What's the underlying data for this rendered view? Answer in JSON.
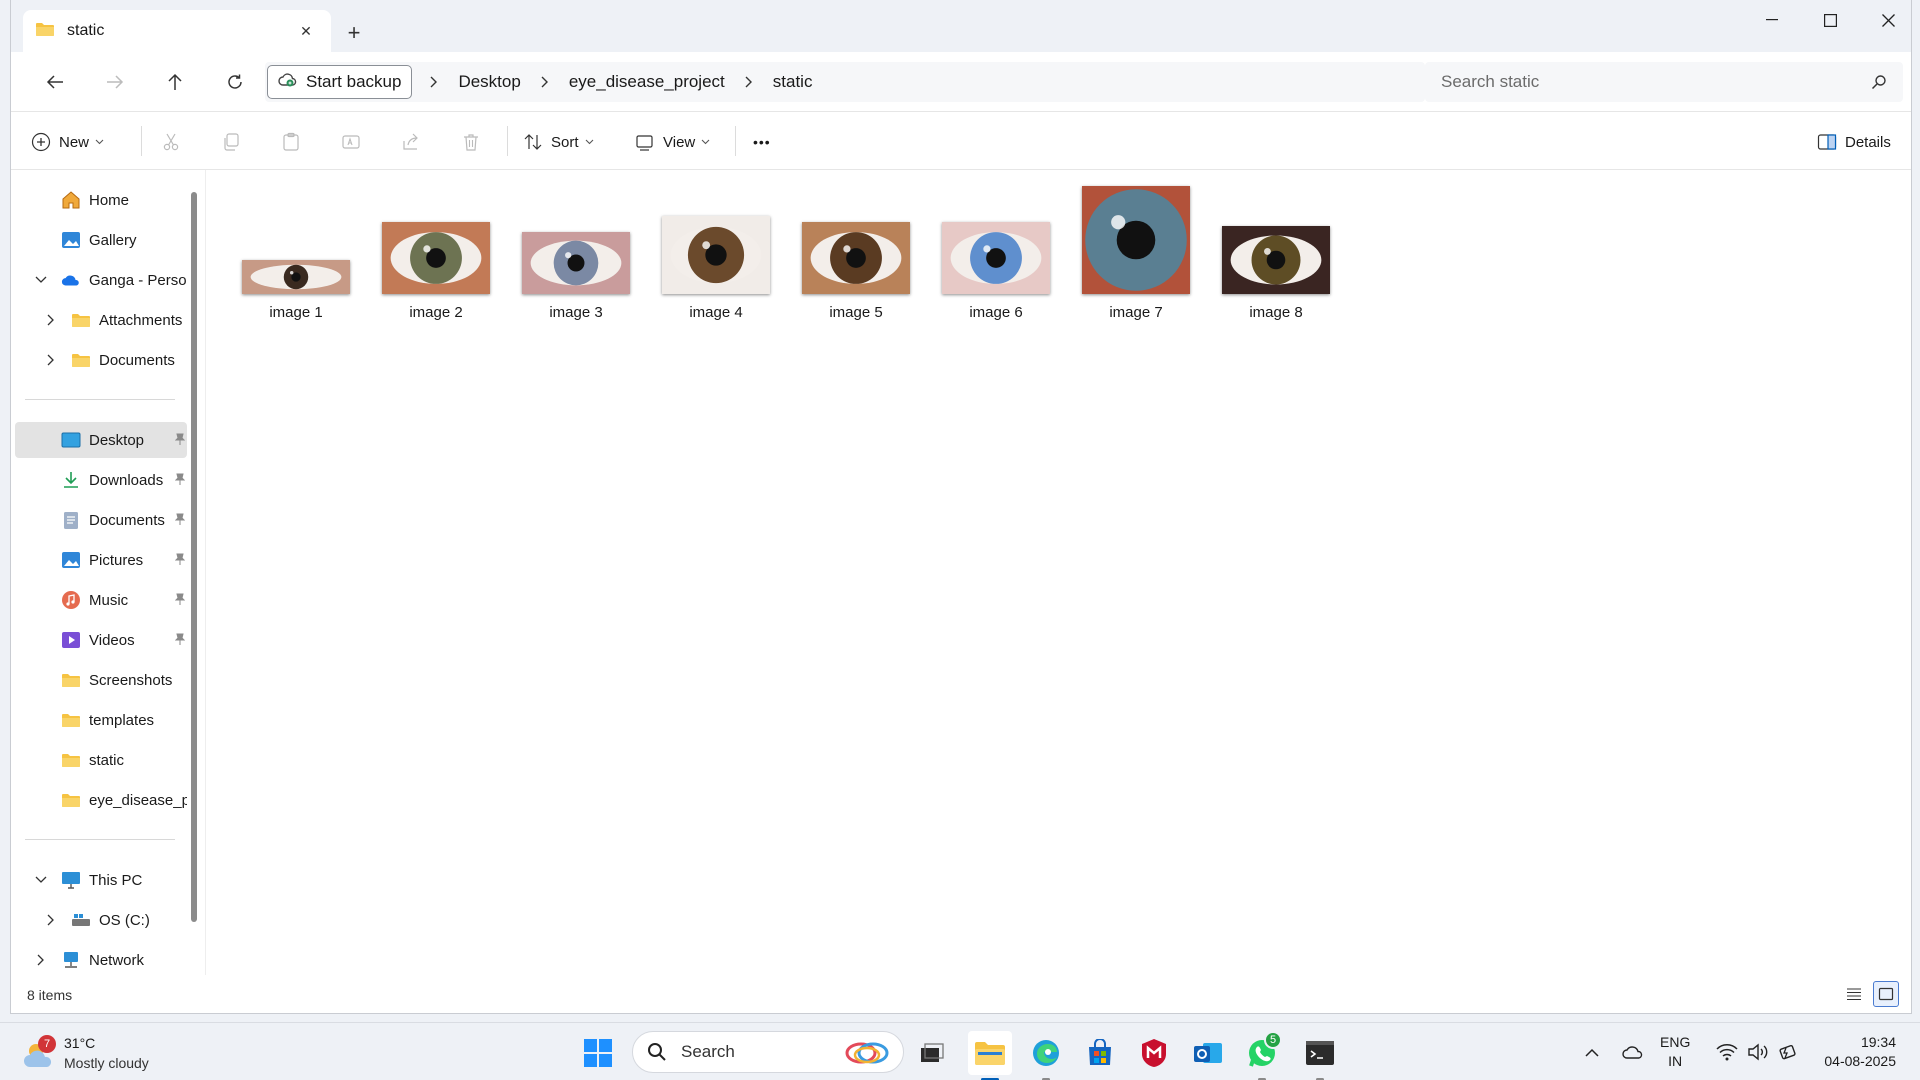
{
  "tab": {
    "title": "static",
    "close_glyph": "✕",
    "new_glyph": "+"
  },
  "window_controls": {
    "minimize": "—",
    "maximize": "☐",
    "close": "✕"
  },
  "address": {
    "backup_label": "Start backup",
    "crumbs": [
      "Desktop",
      "eye_disease_project",
      "static"
    ],
    "search_placeholder": "Search static"
  },
  "commands": {
    "new": "New",
    "sort": "Sort",
    "view": "View",
    "more": "•••",
    "details": "Details"
  },
  "sidebar": {
    "home": "Home",
    "gallery": "Gallery",
    "onedrive": "Ganga - Personal",
    "attachments": "Attachments",
    "documents_od": "Documents",
    "pinned": [
      {
        "label": "Desktop",
        "icon": "desktop-icon"
      },
      {
        "label": "Downloads",
        "icon": "download-icon"
      },
      {
        "label": "Documents",
        "icon": "documents-icon"
      },
      {
        "label": "Pictures",
        "icon": "pictures-icon"
      },
      {
        "label": "Music",
        "icon": "music-icon"
      },
      {
        "label": "Videos",
        "icon": "videos-icon"
      }
    ],
    "recent": [
      "Screenshots",
      "templates",
      "static",
      "eye_disease_project"
    ],
    "this_pc": "This PC",
    "os_drive": "OS (C:)",
    "network": "Network"
  },
  "files": [
    {
      "name": "image 1",
      "iris": "#3a2a20",
      "skin": "#c79a86"
    },
    {
      "name": "image 2",
      "iris": "#6d7352",
      "skin": "#c27a56"
    },
    {
      "name": "image 3",
      "iris": "#7b89a4",
      "skin": "#c99c9c"
    },
    {
      "name": "image 4",
      "iris": "#6b4a2c",
      "skin": "#f1ece8"
    },
    {
      "name": "image 5",
      "iris": "#5a3b22",
      "skin": "#b98259"
    },
    {
      "name": "image 6",
      "iris": "#5f8fce",
      "skin": "#e7c9c6"
    },
    {
      "name": "image 7",
      "iris": "#5a7f92",
      "skin": "#b2523a"
    },
    {
      "name": "image 8",
      "iris": "#5e4d25",
      "skin": "#3a2522"
    }
  ],
  "status": {
    "item_count": "8 items"
  },
  "taskbar": {
    "weather_temp": "31°C",
    "weather_desc": "Mostly cloudy",
    "weather_badge": "7",
    "search_label": "Search",
    "whatsapp_badge": "5",
    "lang_line1": "ENG",
    "lang_line2": "IN",
    "time": "19:34",
    "date": "04-08-2025"
  },
  "colors": {
    "accent": "#005fb8",
    "folder": "#f6c342",
    "selected": "#e3e3e3"
  }
}
